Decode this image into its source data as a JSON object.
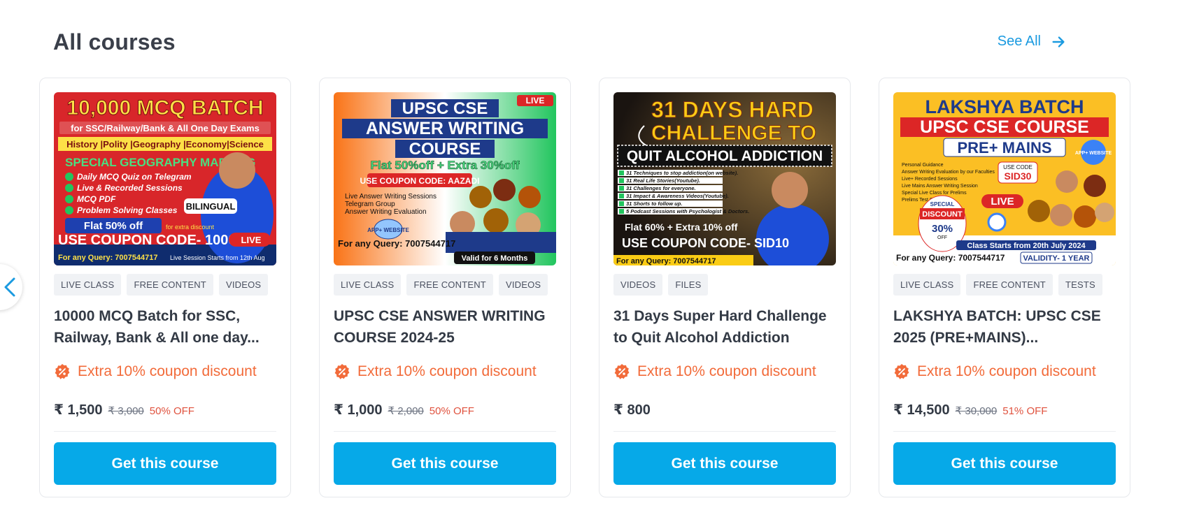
{
  "section": {
    "title": "All courses",
    "see_all_label": "See All"
  },
  "colors": {
    "accent": "#06a9e8",
    "link": "#1a9ae0",
    "coupon": "#f26b3a",
    "discount": "#e0533f"
  },
  "cards": [
    {
      "thumb": {
        "headline": "10,000 MCQ BATCH",
        "subline": "for SSC/Railway/Bank & All One Day Exams",
        "subjects": "History |Polity |Geography |Economy|Science",
        "banner": "SPECIAL GEOGRAPHY MAPPING",
        "bullets": [
          "Daily MCQ Quiz on Telegram",
          "Live & Recorded Sessions",
          "MCQ PDF",
          "Problem Solving Classes"
        ],
        "badge": "BILINGUAL",
        "offer": "Flat 50% off",
        "offer_note": "for extra discount",
        "coupon": "USE COUPON CODE- 10000",
        "live": "LIVE",
        "query": "For any Query: 7007544717",
        "footer_note": "Live Session Starts from 12th Aug"
      },
      "tags": [
        "LIVE CLASS",
        "FREE CONTENT",
        "VIDEOS"
      ],
      "title": "10000 MCQ Batch for SSC, Railway, Bank & All one day...",
      "coupon_text": "Extra 10% coupon discount",
      "price": "₹ 1,500",
      "mrp": "₹ 3,000",
      "off": "50% OFF",
      "cta": "Get this course"
    },
    {
      "thumb": {
        "live": "LIVE",
        "headline1": "UPSC CSE",
        "headline2": "ANSWER WRITING",
        "headline3": "COURSE",
        "offer": "Flat 50%off + Extra 30%off",
        "coupon": "USE COUPON CODE: AAZADI",
        "bullets": [
          "Live Answer Writing Sessions",
          "Telegram Group",
          "Answer Writing Evaluation"
        ],
        "app_badge": "APP+ WEBSITE",
        "query": "For any Query: 7007544717",
        "validity": "Valid for 6 Months"
      },
      "tags": [
        "LIVE CLASS",
        "FREE CONTENT",
        "VIDEOS"
      ],
      "title": "UPSC CSE ANSWER WRITING COURSE 2024-25",
      "coupon_text": "Extra 10% coupon discount",
      "price": "₹ 1,000",
      "mrp": "₹ 2,000",
      "off": "50% OFF",
      "cta": "Get this course"
    },
    {
      "thumb": {
        "headline1": "31 DAYS HARD",
        "headline2": "CHALLENGE TO",
        "banner": "QUIT ALCOHOL ADDICTION",
        "bullets": [
          "31 Techniques to stop addiction(on website).",
          "31 Real Life Stories(Youtube).",
          "31 Challenges for everyone.",
          "31 Impact & Awareness Videos(Youtube).",
          "31 Shorts to follow up.",
          "5 Podcast Sessions with Psychologist & Doctors."
        ],
        "offer": "Flat 60% + Extra 10% off",
        "coupon": "USE COUPON CODE- SID10",
        "query": "For any Query: 7007544717"
      },
      "tags": [
        "VIDEOS",
        "FILES"
      ],
      "title": "31 Days Super Hard Challenge to Quit Alcohol Addiction",
      "coupon_text": "Extra 10% coupon discount",
      "price": "₹ 800",
      "mrp": "",
      "off": "",
      "cta": "Get this course"
    },
    {
      "thumb": {
        "headline1": "LAKSHYA BATCH",
        "headline2": "UPSC CSE COURSE",
        "headline3": "PRE+ MAINS",
        "app_badge": "APP+ WEBSITE",
        "bullets": [
          "Personal Guidance",
          "Answer Writing Evaluation by our Faculties",
          "Live+ Recorded Sessions",
          "Live Mains Answer Writing Session",
          "Special Live Class for Prelims",
          "Prelims Test Series"
        ],
        "use_code": "USE CODE",
        "code": "SID30",
        "special": "SPECIAL",
        "discount": "DISCOUNT",
        "discount_pct": "30%",
        "discount_off": "OFF",
        "live": "LIVE",
        "class_starts": "Class Starts from 20th July 2024",
        "query": "For any Query: 7007544717",
        "validity": "VALIDITY- 1 YEAR"
      },
      "tags": [
        "LIVE CLASS",
        "FREE CONTENT",
        "TESTS"
      ],
      "title": "LAKSHYA BATCH: UPSC CSE 2025 (PRE+MAINS)...",
      "coupon_text": "Extra 10% coupon discount",
      "price": "₹ 14,500",
      "mrp": "₹ 30,000",
      "off": "51% OFF",
      "cta": "Get this course"
    }
  ]
}
